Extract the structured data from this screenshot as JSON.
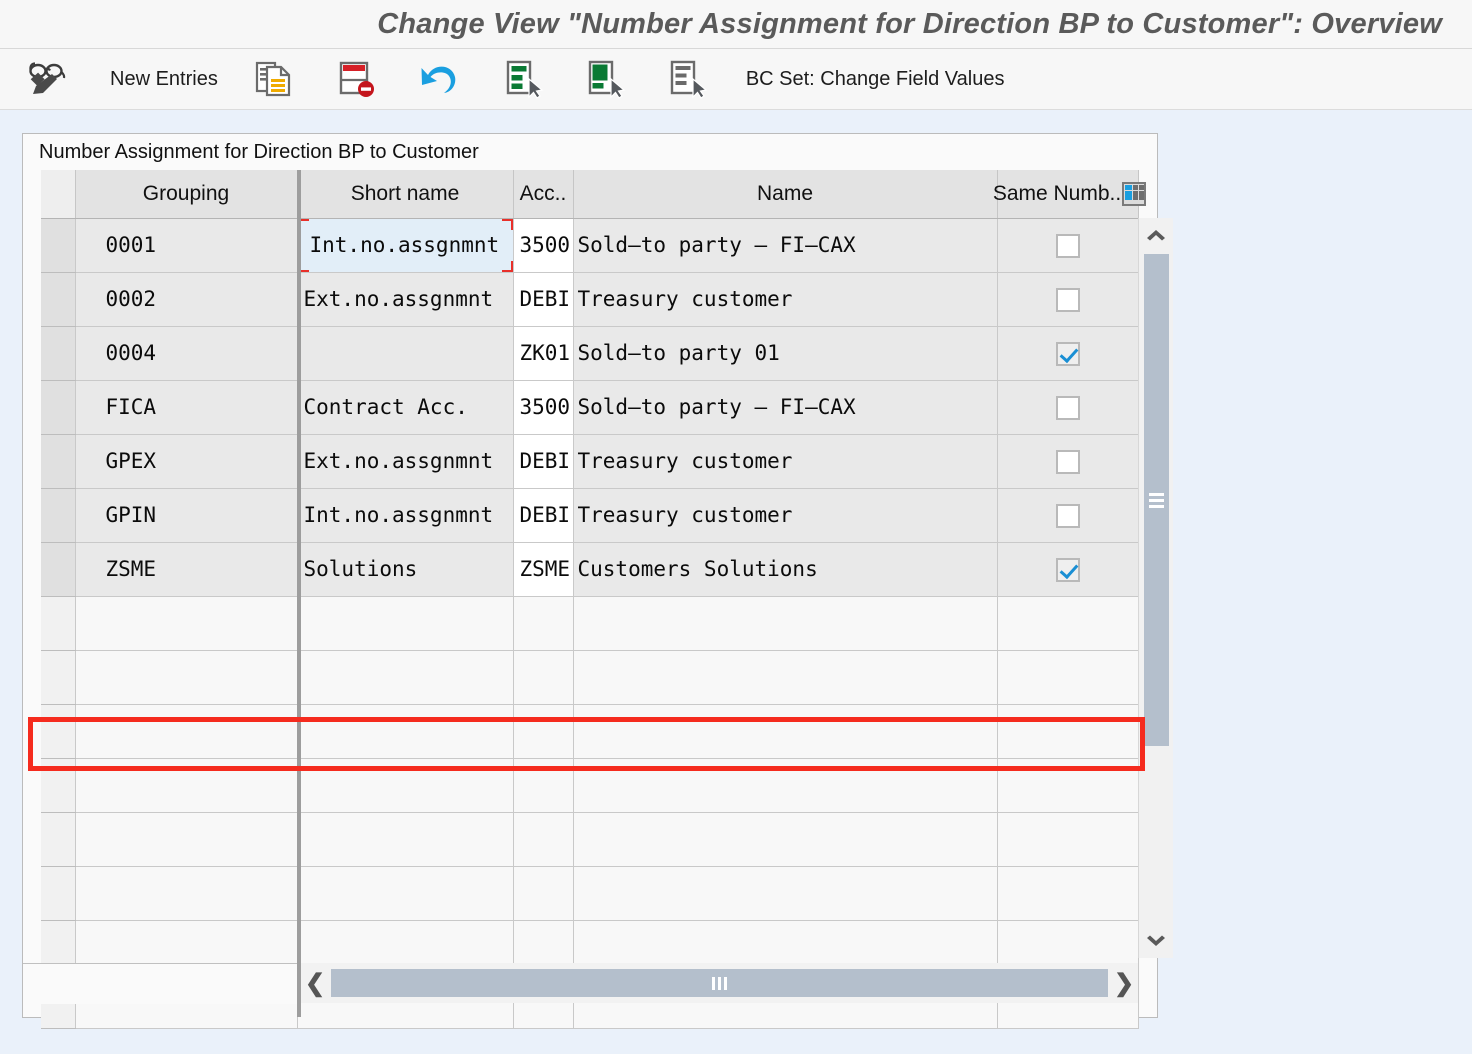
{
  "window": {
    "title": "Change View \"Number Assignment for Direction BP to Customer\": Overview"
  },
  "toolbar": {
    "display_change_icon": "glasses-pencil-icon",
    "new_entries_label": "New Entries",
    "copy_as_icon": "copy-as-icon",
    "delete_icon": "delete-row-icon",
    "undo_icon": "undo-icon",
    "select_all_icon": "select-all-icon",
    "select_block_icon": "select-block-icon",
    "deselect_all_icon": "deselect-all-icon",
    "bc_set_icon": "bc-set-icon",
    "bc_set_label": "BC Set: Change Field Values"
  },
  "panel": {
    "caption": "Number Assignment for Direction BP to Customer"
  },
  "table": {
    "columns": [
      {
        "key": "sel",
        "label": ""
      },
      {
        "key": "grouping",
        "label": "Grouping"
      },
      {
        "key": "short",
        "label": "Short name"
      },
      {
        "key": "acc",
        "label": "Acc.."
      },
      {
        "key": "name",
        "label": "Name"
      },
      {
        "key": "same",
        "label": "Same Numb.."
      }
    ],
    "settings_icon": "table-settings-icon",
    "rows": [
      {
        "grouping": "0001",
        "short": "Int.no.assgnmnt",
        "acc": "3500",
        "name": "Sold–to party – FI–CAX",
        "same": false,
        "focused": true
      },
      {
        "grouping": "0002",
        "short": "Ext.no.assgnmnt",
        "acc": "DEBI",
        "name": "Treasury customer",
        "same": false,
        "focused": false
      },
      {
        "grouping": "0004",
        "short": "",
        "acc": "ZK01",
        "name": "Sold–to party 01",
        "same": true,
        "focused": false
      },
      {
        "grouping": "FICA",
        "short": "Contract Acc.",
        "acc": "3500",
        "name": "Sold–to party – FI–CAX",
        "same": false,
        "focused": false
      },
      {
        "grouping": "GPEX",
        "short": "Ext.no.assgnmnt",
        "acc": "DEBI",
        "name": "Treasury customer",
        "same": false,
        "focused": false
      },
      {
        "grouping": "GPIN",
        "short": "Int.no.assgnmnt",
        "acc": "DEBI",
        "name": "Treasury customer",
        "same": false,
        "focused": false
      },
      {
        "grouping": "ZSME",
        "short": "Solutions",
        "acc": "ZSME",
        "name": "Customers Solutions",
        "same": true,
        "focused": false,
        "highlighted": true
      }
    ],
    "empty_row_count": 8
  },
  "scrollbars": {
    "vertical_up_icon": "chevron-up-icon",
    "vertical_down_icon": "chevron-down-icon",
    "horizontal_left_icon": "chevron-left-icon",
    "horizontal_right_icon": "chevron-right-icon"
  },
  "colors": {
    "page_background": "#eaf1fa",
    "panel_background": "#fafafa",
    "header_cell": "#e3e3e3",
    "row_cell": "#e9e9e9",
    "highlight_red": "#f52b1e",
    "focus_cell": "#e2eef8",
    "accent_blue": "#1a8fd4",
    "scroll_thumb": "#b4bfcc"
  }
}
